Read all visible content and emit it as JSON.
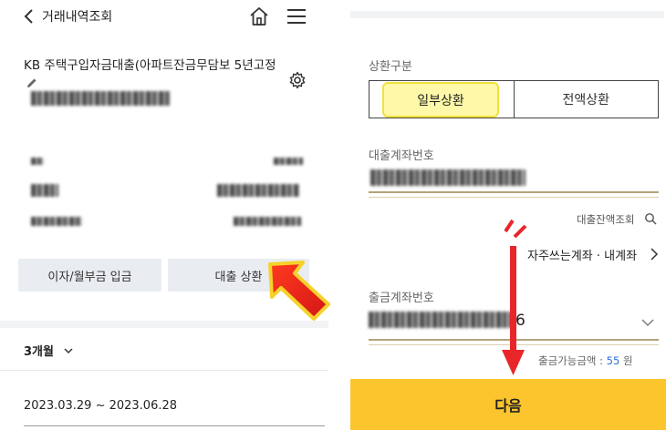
{
  "left": {
    "header": {
      "title": "거래내역조회"
    },
    "loan_name": "KB 주택구입자금대출(아파트잔금무담보 5년고정",
    "buttons": {
      "interest": "이자/월부금 입금",
      "repay": "대출 상환"
    },
    "period": "3개월",
    "date_range": "2023.03.29 ~ 2023.06.28"
  },
  "right": {
    "repay_type_label": "상환구분",
    "repay_type_options": [
      "일부상환",
      "전액상환"
    ],
    "selected_option": "일부상환",
    "loan_account_label": "대출계좌번호",
    "balance_inquiry": "대출잔액조회",
    "frequent_accounts": "자주쓰는계좌 · 내계좌",
    "withdraw_label": "출금계좌번호",
    "withdraw_account_suffix": "6",
    "available_label": "출금가능금액 :",
    "available_amount": "55",
    "available_unit": "원",
    "next_button": "다음"
  },
  "colors": {
    "next_button": "#fcc52d",
    "highlight": "#fff8a8",
    "annotation_arrow": "#e8262a",
    "available_amount": "#2b6fd8"
  },
  "icons": [
    "back-icon",
    "home-icon",
    "menu-icon",
    "edit-icon",
    "gear-icon",
    "chevron-down-icon",
    "search-icon",
    "chevron-right-icon"
  ]
}
